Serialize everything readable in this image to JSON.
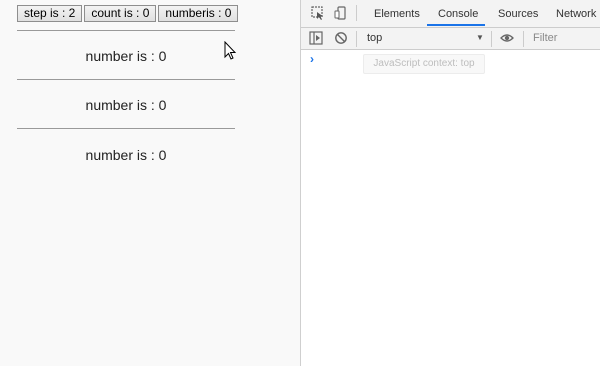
{
  "page": {
    "buttons": [
      {
        "label": "step is : 2"
      },
      {
        "label": "count is : 0"
      },
      {
        "label": "numberis : 0"
      }
    ],
    "lines": [
      {
        "text": "number is : 0"
      },
      {
        "text": "number is : 0"
      },
      {
        "text": "number is : 0"
      }
    ]
  },
  "devtools": {
    "tabs": [
      {
        "label": "Elements"
      },
      {
        "label": "Console"
      },
      {
        "label": "Sources"
      },
      {
        "label": "Network"
      }
    ],
    "active_tab": "Console",
    "context": "top",
    "filter_placeholder": "Filter",
    "tooltip": "JavaScript context: top",
    "prompt": "›",
    "accent": "#1a73e8"
  }
}
